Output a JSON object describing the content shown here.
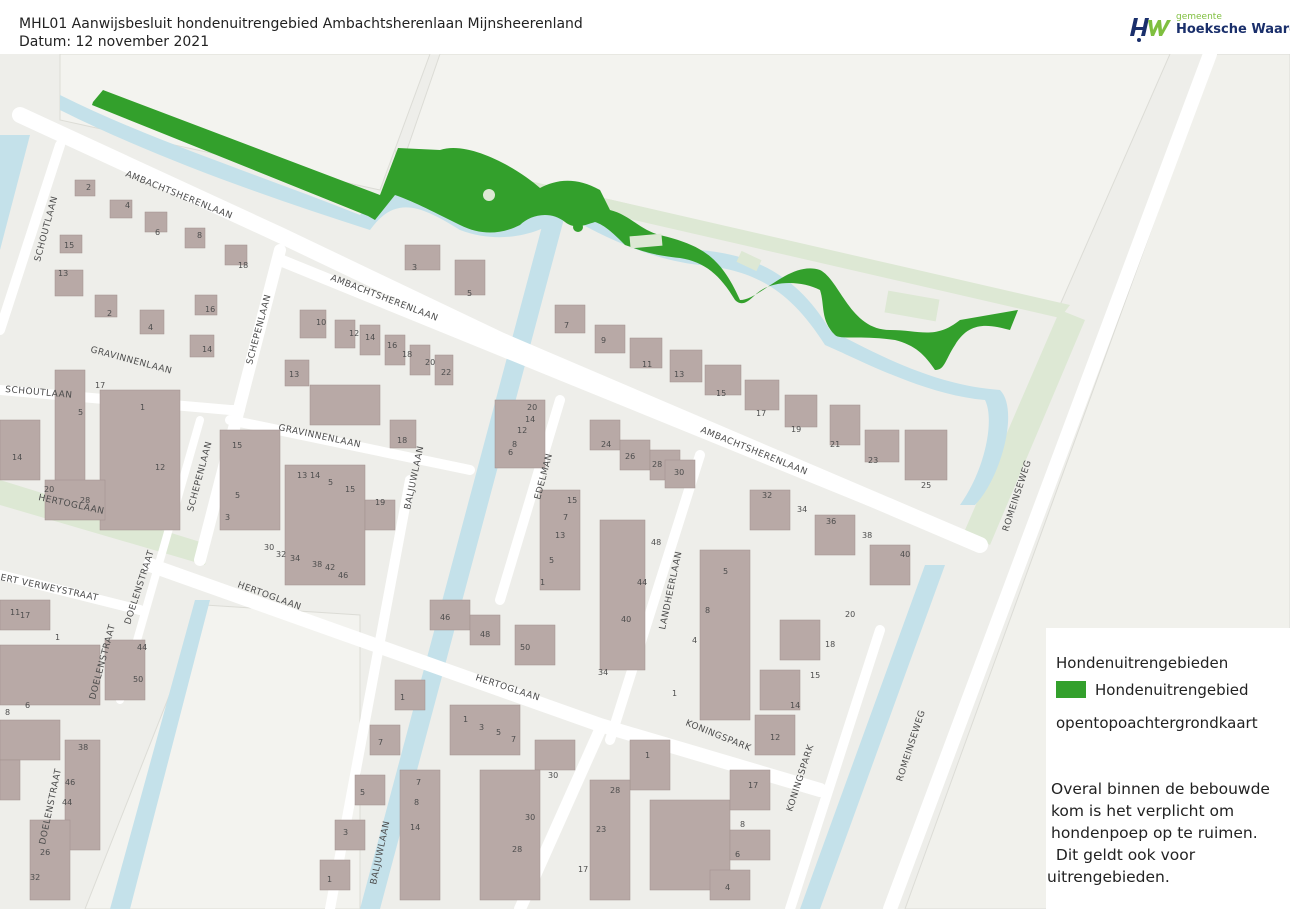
{
  "header": {
    "title": "MHL01 Aanwijsbesluit hondenuitrengebied Ambachtsherenlaan Mijnsheerenland",
    "date": "Datum: 12 november 2021"
  },
  "logo": {
    "mark": "HW",
    "small": "gemeente",
    "name": "Hoeksche Waard",
    "colors": {
      "h": "#1a2f6b",
      "w": "#7fbf3f"
    }
  },
  "legend": {
    "title": "Hondenuitrengebieden",
    "item_label": "Hondenuitrengebied",
    "item_color": "#33a02c",
    "basemap": "opentopoachtergrondkaart",
    "note_lines": [
      "Overal binnen de bebouwde",
      "kom is het verplicht om",
      "hondenpoep op te ruimen.",
      " Dit geldt ook voor",
      "uitrengebieden."
    ]
  },
  "map": {
    "colors": {
      "background": "#eeeeea",
      "field": "#f3f3ef",
      "water": "#c4e1ea",
      "road": "#ffffff",
      "building": "#b8a9a6",
      "area": "#33a02c",
      "green": "#dde8d4"
    },
    "streets": {
      "ambachtsherenlaan": "AMBACHTSHERENLAAN",
      "schoutlaan": "SCHOUTLAAN",
      "schepenlaan": "SCHEPENLAAN",
      "gravinnenlaan": "GRAVINNENLAAN",
      "baljuwlaan": "BALJUWLAAN",
      "hertoglaan": "HERTOGLAAN",
      "edelman": "EDELMAN",
      "landheerlaan": "LANDHEERLAAN",
      "koningspark": "KONINGSPARK",
      "romeinseweg": "ROMEINSEWEG",
      "doelenstraat": "DOELENSTRAAT",
      "verweystraat": "ERT VERWEYSTRAAT"
    },
    "house_numbers": [
      "2",
      "4",
      "6",
      "8",
      "10",
      "12",
      "14",
      "15",
      "16",
      "18",
      "3",
      "5",
      "1",
      "7",
      "9",
      "11",
      "13",
      "17",
      "19",
      "20",
      "21",
      "22",
      "23",
      "24",
      "25",
      "26",
      "28",
      "30",
      "32",
      "34",
      "36",
      "38",
      "40",
      "42",
      "44",
      "46",
      "48",
      "50"
    ]
  }
}
